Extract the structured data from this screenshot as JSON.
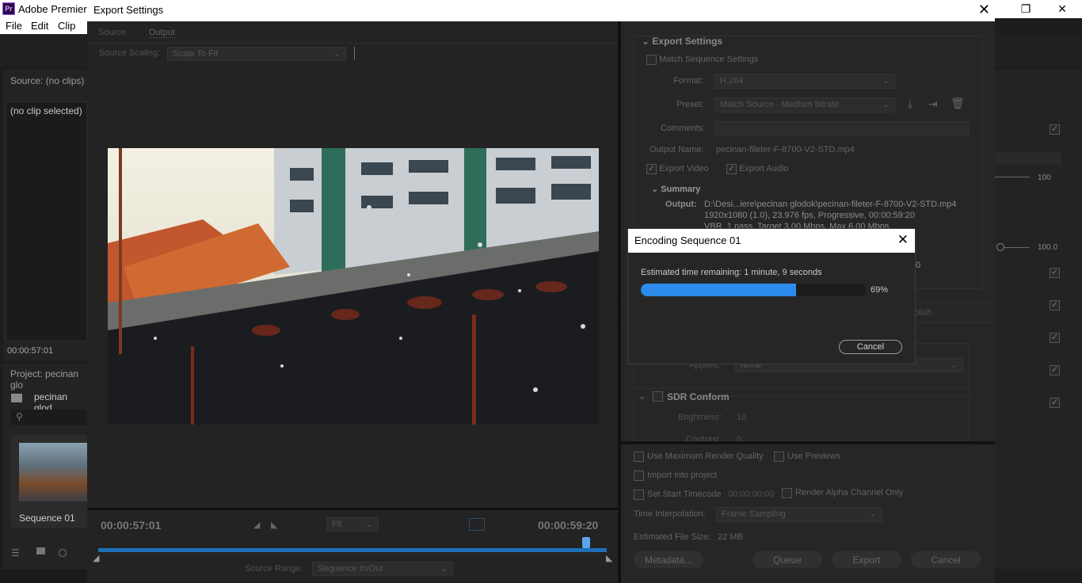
{
  "app": {
    "logo": "Pr",
    "title": "Adobe Premiere",
    "menu": [
      "File",
      "Edit",
      "Clip"
    ],
    "source_panel_title": "Source: (no clips)",
    "no_clip": "(no clip selected)",
    "source_timecode": "00:00:57:01",
    "project_title": "Project: pecinan glo",
    "project_bin": "pecinan glod",
    "thumb_label": "Sequence 01",
    "right_values": [
      "100",
      "100.0",
      "0"
    ],
    "publish_tab": "blish"
  },
  "export_dialog": {
    "title": "Export Settings",
    "tabs": [
      "Source",
      "Output"
    ],
    "source_scaling_label": "Source Scaling:",
    "source_scaling_value": "Scale To Fit",
    "export_settings_heading": "Export Settings",
    "match_sequence": "Match Sequence Settings",
    "format_label": "Format:",
    "format_value": "H.264",
    "preset_label": "Preset:",
    "preset_value": "Match Source - Medium bitrate",
    "comments_label": "Comments:",
    "output_name_label": "Output Name:",
    "output_name_value": "pecinan-fileter-F-8700-V2-STD.mp4",
    "export_video": "Export Video",
    "export_audio": "Export Audio",
    "summary_heading": "Summary",
    "output_label": "Output:",
    "output_line1": "D:\\Desi...iere\\pecinan glodok\\pecinan-fileter-F-8700-V2-STD.mp4",
    "output_line2": "1920x1080 (1.0), 23.976 fps, Progressive, 00:00:59:20",
    "output_line3": "VBR, 1 pass, Target 3.00 Mbps, Max 6.00 Mbps",
    "applied_label": "Applied:",
    "applied_value": "None",
    "sdr_conform": "SDR Conform",
    "brightness_label": "Brightness:",
    "brightness_value": "10",
    "contrast_label": "Contrast:",
    "contrast_value": "0",
    "use_max_render": "Use Maximum Render Quality",
    "use_previews": "Use Previews",
    "import_project": "Import into project",
    "set_start_timecode": "Set Start Timecode",
    "start_timecode_value": "00:00:00:00",
    "render_alpha": "Render Alpha Channel Only",
    "time_interp_label": "Time Interpolation:",
    "time_interp_value": "Frame Sampling",
    "est_size_label": "Estimated File Size:",
    "est_size_value": "22 MB",
    "buttons": [
      "Metadata...",
      "Queue",
      "Export",
      "Cancel"
    ],
    "timecode_in": "00:00:57:01",
    "timecode_out": "00:00:59:20",
    "fit_value": "Fit",
    "source_range_label": "Source Range:",
    "source_range_value": "Sequence In/Out",
    "playhead_fraction": 0.96
  },
  "encoding": {
    "title": "Encoding Sequence 01",
    "remaining": "Estimated time remaining: 1 minute, 9 seconds",
    "progress": 0.69,
    "percent_label": "69%",
    "cancel": "Cancel"
  },
  "colors": {
    "accent": "#2d8ceb",
    "progress_track": "#1c1c1c",
    "dialog_bg": "#262626"
  }
}
